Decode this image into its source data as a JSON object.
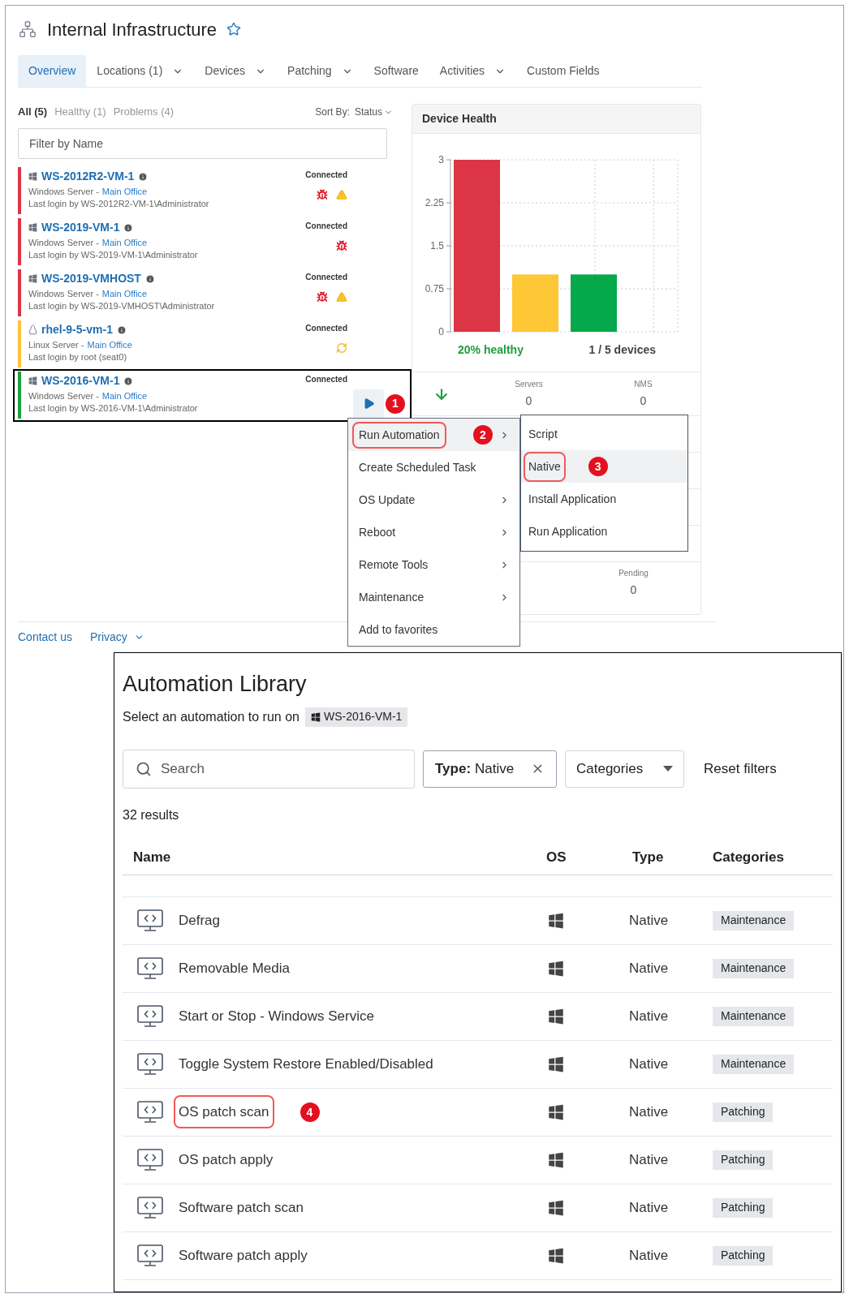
{
  "header": {
    "title": "Internal Infrastructure",
    "favorite": false
  },
  "tabs": [
    {
      "label": "Overview",
      "selected": true,
      "dropdown": false
    },
    {
      "label": "Locations (1)",
      "selected": false,
      "dropdown": true
    },
    {
      "label": "Devices",
      "selected": false,
      "dropdown": true
    },
    {
      "label": "Patching",
      "selected": false,
      "dropdown": true
    },
    {
      "label": "Software",
      "selected": false,
      "dropdown": false
    },
    {
      "label": "Activities",
      "selected": false,
      "dropdown": true
    },
    {
      "label": "Custom Fields",
      "selected": false,
      "dropdown": false
    }
  ],
  "device_filters": [
    {
      "label": "All (5)",
      "selected": true
    },
    {
      "label": "Healthy (1)",
      "selected": false
    },
    {
      "label": "Problems (4)",
      "selected": false
    }
  ],
  "sort": {
    "label": "Sort By:",
    "value": "Status"
  },
  "filter_field": {
    "placeholder": "Filter by Name"
  },
  "devices": [
    {
      "name": "WS-2012R2-VM-1",
      "kind": "windows",
      "os": "Windows Server -",
      "location": "Main Office",
      "last_login": "Last login by WS-2012R2-VM-1\\Administrator",
      "status": "Connected",
      "color": "#dc3545",
      "alerts": [
        {
          "kind": "bug"
        },
        {
          "kind": "warning"
        }
      ],
      "action": false,
      "outlined": false
    },
    {
      "name": "WS-2019-VM-1",
      "kind": "windows",
      "os": "Windows Server -",
      "location": "Main Office",
      "last_login": "Last login by WS-2019-VM-1\\Administrator",
      "status": "Connected",
      "color": "#dc3545",
      "alerts": [
        {
          "kind": "bug"
        }
      ],
      "action": false,
      "outlined": false
    },
    {
      "name": "WS-2019-VMHOST",
      "kind": "windows",
      "os": "Windows Server -",
      "location": "Main Office",
      "last_login": "Last login by WS-2019-VMHOST\\Administrator",
      "status": "Connected",
      "color": "#dc3545",
      "alerts": [
        {
          "kind": "bug"
        },
        {
          "kind": "warning"
        }
      ],
      "action": false,
      "outlined": false
    },
    {
      "name": "rhel-9-5-vm-1",
      "kind": "linux",
      "os": "Linux Server -",
      "location": "Main Office",
      "last_login": "Last login by root (seat0)",
      "status": "Connected",
      "color": "#f9c33a",
      "alerts": [
        {
          "kind": "sync"
        }
      ],
      "action": false,
      "outlined": false
    },
    {
      "name": "WS-2016-VM-1",
      "kind": "windows",
      "os": "Windows Server -",
      "location": "Main Office",
      "last_login": "Last login by WS-2016-VM-1\\Administrator",
      "status": "Connected",
      "color": "#1e9e3e",
      "action": true,
      "outlined": true,
      "callout": "1"
    }
  ],
  "health": {
    "title": "Device Health",
    "chart_data": {
      "type": "bar",
      "values": [
        3,
        1,
        1
      ],
      "colors": [
        "#dc3545",
        "#fdc735",
        "#05a84a"
      ],
      "ylim": [
        0,
        3
      ],
      "yticks": [
        0,
        0.75,
        1.5,
        2.25,
        3
      ],
      "grid": true
    },
    "healthy_label": "20% healthy",
    "devices_label": "1 / 5 devices",
    "trend": {
      "kind": "down"
    },
    "stats": [
      {
        "label": "Servers",
        "value": "0"
      },
      {
        "label": "NMS",
        "value": "0"
      }
    ],
    "stats_2": [
      {
        "label": "Pending",
        "value": "0"
      }
    ]
  },
  "context_menu": [
    {
      "label": "Run Automation",
      "submenu": true,
      "selected": true,
      "outlined": true,
      "callout": "2"
    },
    {
      "label": "Create Scheduled Task",
      "submenu": false,
      "selected": false,
      "outlined": false
    },
    {
      "label": "OS Update",
      "submenu": true,
      "selected": false,
      "outlined": false
    },
    {
      "label": "Reboot",
      "submenu": true,
      "selected": false,
      "outlined": false
    },
    {
      "label": "Remote Tools",
      "submenu": true,
      "selected": false,
      "outlined": false
    },
    {
      "label": "Maintenance",
      "submenu": true,
      "selected": false,
      "outlined": false
    },
    {
      "label": "Add to favorites",
      "submenu": false,
      "selected": false,
      "outlined": false
    }
  ],
  "submenu": [
    {
      "label": "Script",
      "selected": false,
      "outlined": false
    },
    {
      "label": "Native",
      "selected": true,
      "outlined": true,
      "callout": "3"
    },
    {
      "label": "Install Application",
      "selected": false,
      "outlined": false
    },
    {
      "label": "Run Application",
      "selected": false,
      "outlined": false
    }
  ],
  "footer": [
    {
      "label": "Contact us",
      "dropdown": false
    },
    {
      "label": "Privacy",
      "dropdown": true
    }
  ],
  "library": {
    "title": "Automation Library",
    "subtitle": "Select an automation to run on",
    "target": "WS-2016-VM-1",
    "search": {
      "placeholder": "Search"
    },
    "type_filter": {
      "key": "Type:",
      "value": "Native"
    },
    "categories": "Categories",
    "reset": "Reset filters",
    "results": "32 results",
    "columns": [
      "Name",
      "OS",
      "Type",
      "Categories"
    ],
    "rows": [
      {
        "name": "Defrag",
        "kind": "windows",
        "type": "Native",
        "category": "Maintenance",
        "outlined": false
      },
      {
        "name": "Removable Media",
        "kind": "windows",
        "type": "Native",
        "category": "Maintenance",
        "outlined": false
      },
      {
        "name": "Start or Stop - Windows Service",
        "kind": "windows",
        "type": "Native",
        "category": "Maintenance",
        "outlined": false
      },
      {
        "name": "Toggle System Restore Enabled/Disabled",
        "kind": "windows",
        "type": "Native",
        "category": "Maintenance",
        "outlined": false
      },
      {
        "name": "OS patch scan",
        "kind": "windows",
        "type": "Native",
        "category": "Patching",
        "outlined": true,
        "callout": "4"
      },
      {
        "name": "OS patch apply",
        "kind": "windows",
        "type": "Native",
        "category": "Patching",
        "outlined": false
      },
      {
        "name": "Software patch scan",
        "kind": "windows",
        "type": "Native",
        "category": "Patching",
        "outlined": false
      },
      {
        "name": "Software patch apply",
        "kind": "windows",
        "type": "Native",
        "category": "Patching",
        "outlined": false
      }
    ]
  }
}
